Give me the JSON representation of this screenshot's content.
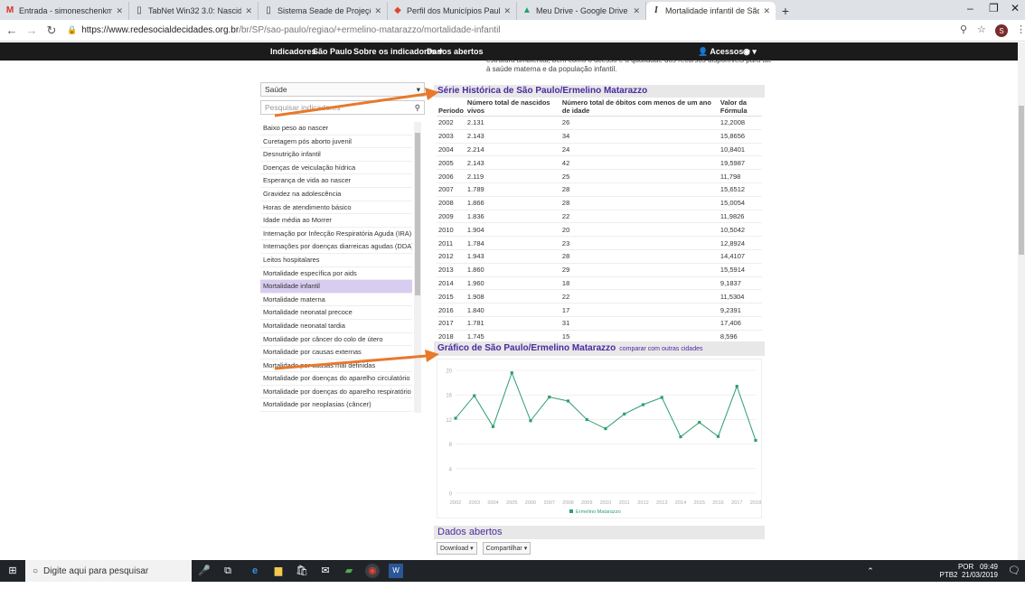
{
  "browser": {
    "tabs": [
      {
        "label": "Entrada - simoneschenkman@u",
        "icon": "gmail-icon"
      },
      {
        "label": "TabNet Win32 3.0: Nascidos Vivo",
        "icon": "page-icon"
      },
      {
        "label": "Sistema Seade de Projeções Pop",
        "icon": "page-icon"
      },
      {
        "label": "Perfil dos Municípios Paulistas |",
        "icon": "seade-icon"
      },
      {
        "label": "Meu Drive - Google Drive",
        "icon": "drive-icon"
      },
      {
        "label": "Mortalidade infantil de São Paulo",
        "icon": "italic-i-icon"
      }
    ],
    "new_tab": "+",
    "url_host": "https://www.redesocialdecidades.org.br",
    "url_path": "/br/SP/sao-paulo/regiao/+ermelino-matarazzo/mortalidade-infantil",
    "avatar_letter": "S"
  },
  "site_nav": {
    "items": [
      "Indicadores",
      "São Paulo",
      "Sobre os indicadores",
      "Dados abertos"
    ],
    "access": "Acessos",
    "intro_line1": "estrutura ambiental, bem como o acesso e a qualidade dos recursos disponíveis para atenção",
    "intro_line2": "à saúde materna e da população infantil."
  },
  "sidebar": {
    "area": "Saúde",
    "search_placeholder": "Pesquisar indicadores",
    "items": [
      "Baixo peso ao nascer",
      "Curetagem pós aborto juvenil",
      "Desnutrição infantil",
      "Doenças de veiculação hídrica",
      "Esperança de vida ao nascer",
      "Gravidez na adolescência",
      "Horas de atendimento básico",
      "Idade média ao Morrer",
      "Internação por Infecção Respiratória Aguda (IRA)",
      "Internações por doenças diarreicas agudas (DDA)",
      "Leitos hospitalares",
      "Mortalidade específica por aids",
      "Mortalidade infantil",
      "Mortalidade materna",
      "Mortalidade neonatal precoce",
      "Mortalidade neonatal tardia",
      "Mortalidade por câncer do colo de útero",
      "Mortalidade por causas externas",
      "Mortalidade por causas mal definidas",
      "Mortalidade por doenças do aparelho circulatório",
      "Mortalidade por doenças do aparelho respiratório",
      "Mortalidade por neoplasias (câncer)"
    ],
    "selected_index": 12
  },
  "series_table": {
    "title": "Série Histórica de São Paulo/Ermelino Matarazzo",
    "headers": [
      "Período",
      "Número total de nascidos vivos",
      "Número total de óbitos com menos de um ano de idade",
      "Valor da Fórmula"
    ],
    "rows": [
      [
        "2002",
        "2.131",
        "26",
        "12,2008"
      ],
      [
        "2003",
        "2.143",
        "34",
        "15,8656"
      ],
      [
        "2004",
        "2.214",
        "24",
        "10,8401"
      ],
      [
        "2005",
        "2.143",
        "42",
        "19,5987"
      ],
      [
        "2006",
        "2.119",
        "25",
        "11,798"
      ],
      [
        "2007",
        "1.789",
        "28",
        "15,6512"
      ],
      [
        "2008",
        "1.866",
        "28",
        "15,0054"
      ],
      [
        "2009",
        "1.836",
        "22",
        "11,9826"
      ],
      [
        "2010",
        "1.904",
        "20",
        "10,5042"
      ],
      [
        "2011",
        "1.784",
        "23",
        "12,8924"
      ],
      [
        "2012",
        "1.943",
        "28",
        "14,4107"
      ],
      [
        "2013",
        "1.860",
        "29",
        "15,5914"
      ],
      [
        "2014",
        "1.960",
        "18",
        "9,1837"
      ],
      [
        "2015",
        "1.908",
        "22",
        "11,5304"
      ],
      [
        "2016",
        "1.840",
        "17",
        "9,2391"
      ],
      [
        "2017",
        "1.781",
        "31",
        "17,406"
      ],
      [
        "2018",
        "1.745",
        "15",
        "8,596"
      ]
    ]
  },
  "chart_section": {
    "title": "Gráfico de São Paulo/Ermelino Matarazzo",
    "compare_link": "comparar com outras cidades"
  },
  "chart_data": {
    "type": "line",
    "x": [
      "2002",
      "2003",
      "2004",
      "2005",
      "2006",
      "2007",
      "2008",
      "2009",
      "2010",
      "2011",
      "2012",
      "2013",
      "2014",
      "2015",
      "2016",
      "2017",
      "2018"
    ],
    "series": [
      {
        "name": "Ermelino Matarazzo",
        "values": [
          12.2008,
          15.8656,
          10.8401,
          19.5987,
          11.798,
          15.6512,
          15.0054,
          11.9826,
          10.5042,
          12.8924,
          14.4107,
          15.5914,
          9.1837,
          11.5304,
          9.2391,
          17.406,
          8.596
        ],
        "color": "#2e9e6e"
      }
    ],
    "y_ticks": [
      "0",
      "4",
      "8",
      "12",
      "16",
      "20"
    ],
    "ylim": [
      0,
      20
    ],
    "grid": true,
    "legend": "bottom"
  },
  "open_data": {
    "title": "Dados abertos",
    "download": "Download",
    "share": "Compartilhar"
  },
  "taskbar": {
    "search_placeholder": "Digite aqui para pesquisar",
    "lang": "POR",
    "layout": "PTB2",
    "time": "09:49",
    "date": "21/03/2019"
  },
  "colors": {
    "accent": "#4b2aa0",
    "arrow": "#e8792b",
    "selected": "#d9ccf1",
    "line": "#2e9e6e"
  }
}
